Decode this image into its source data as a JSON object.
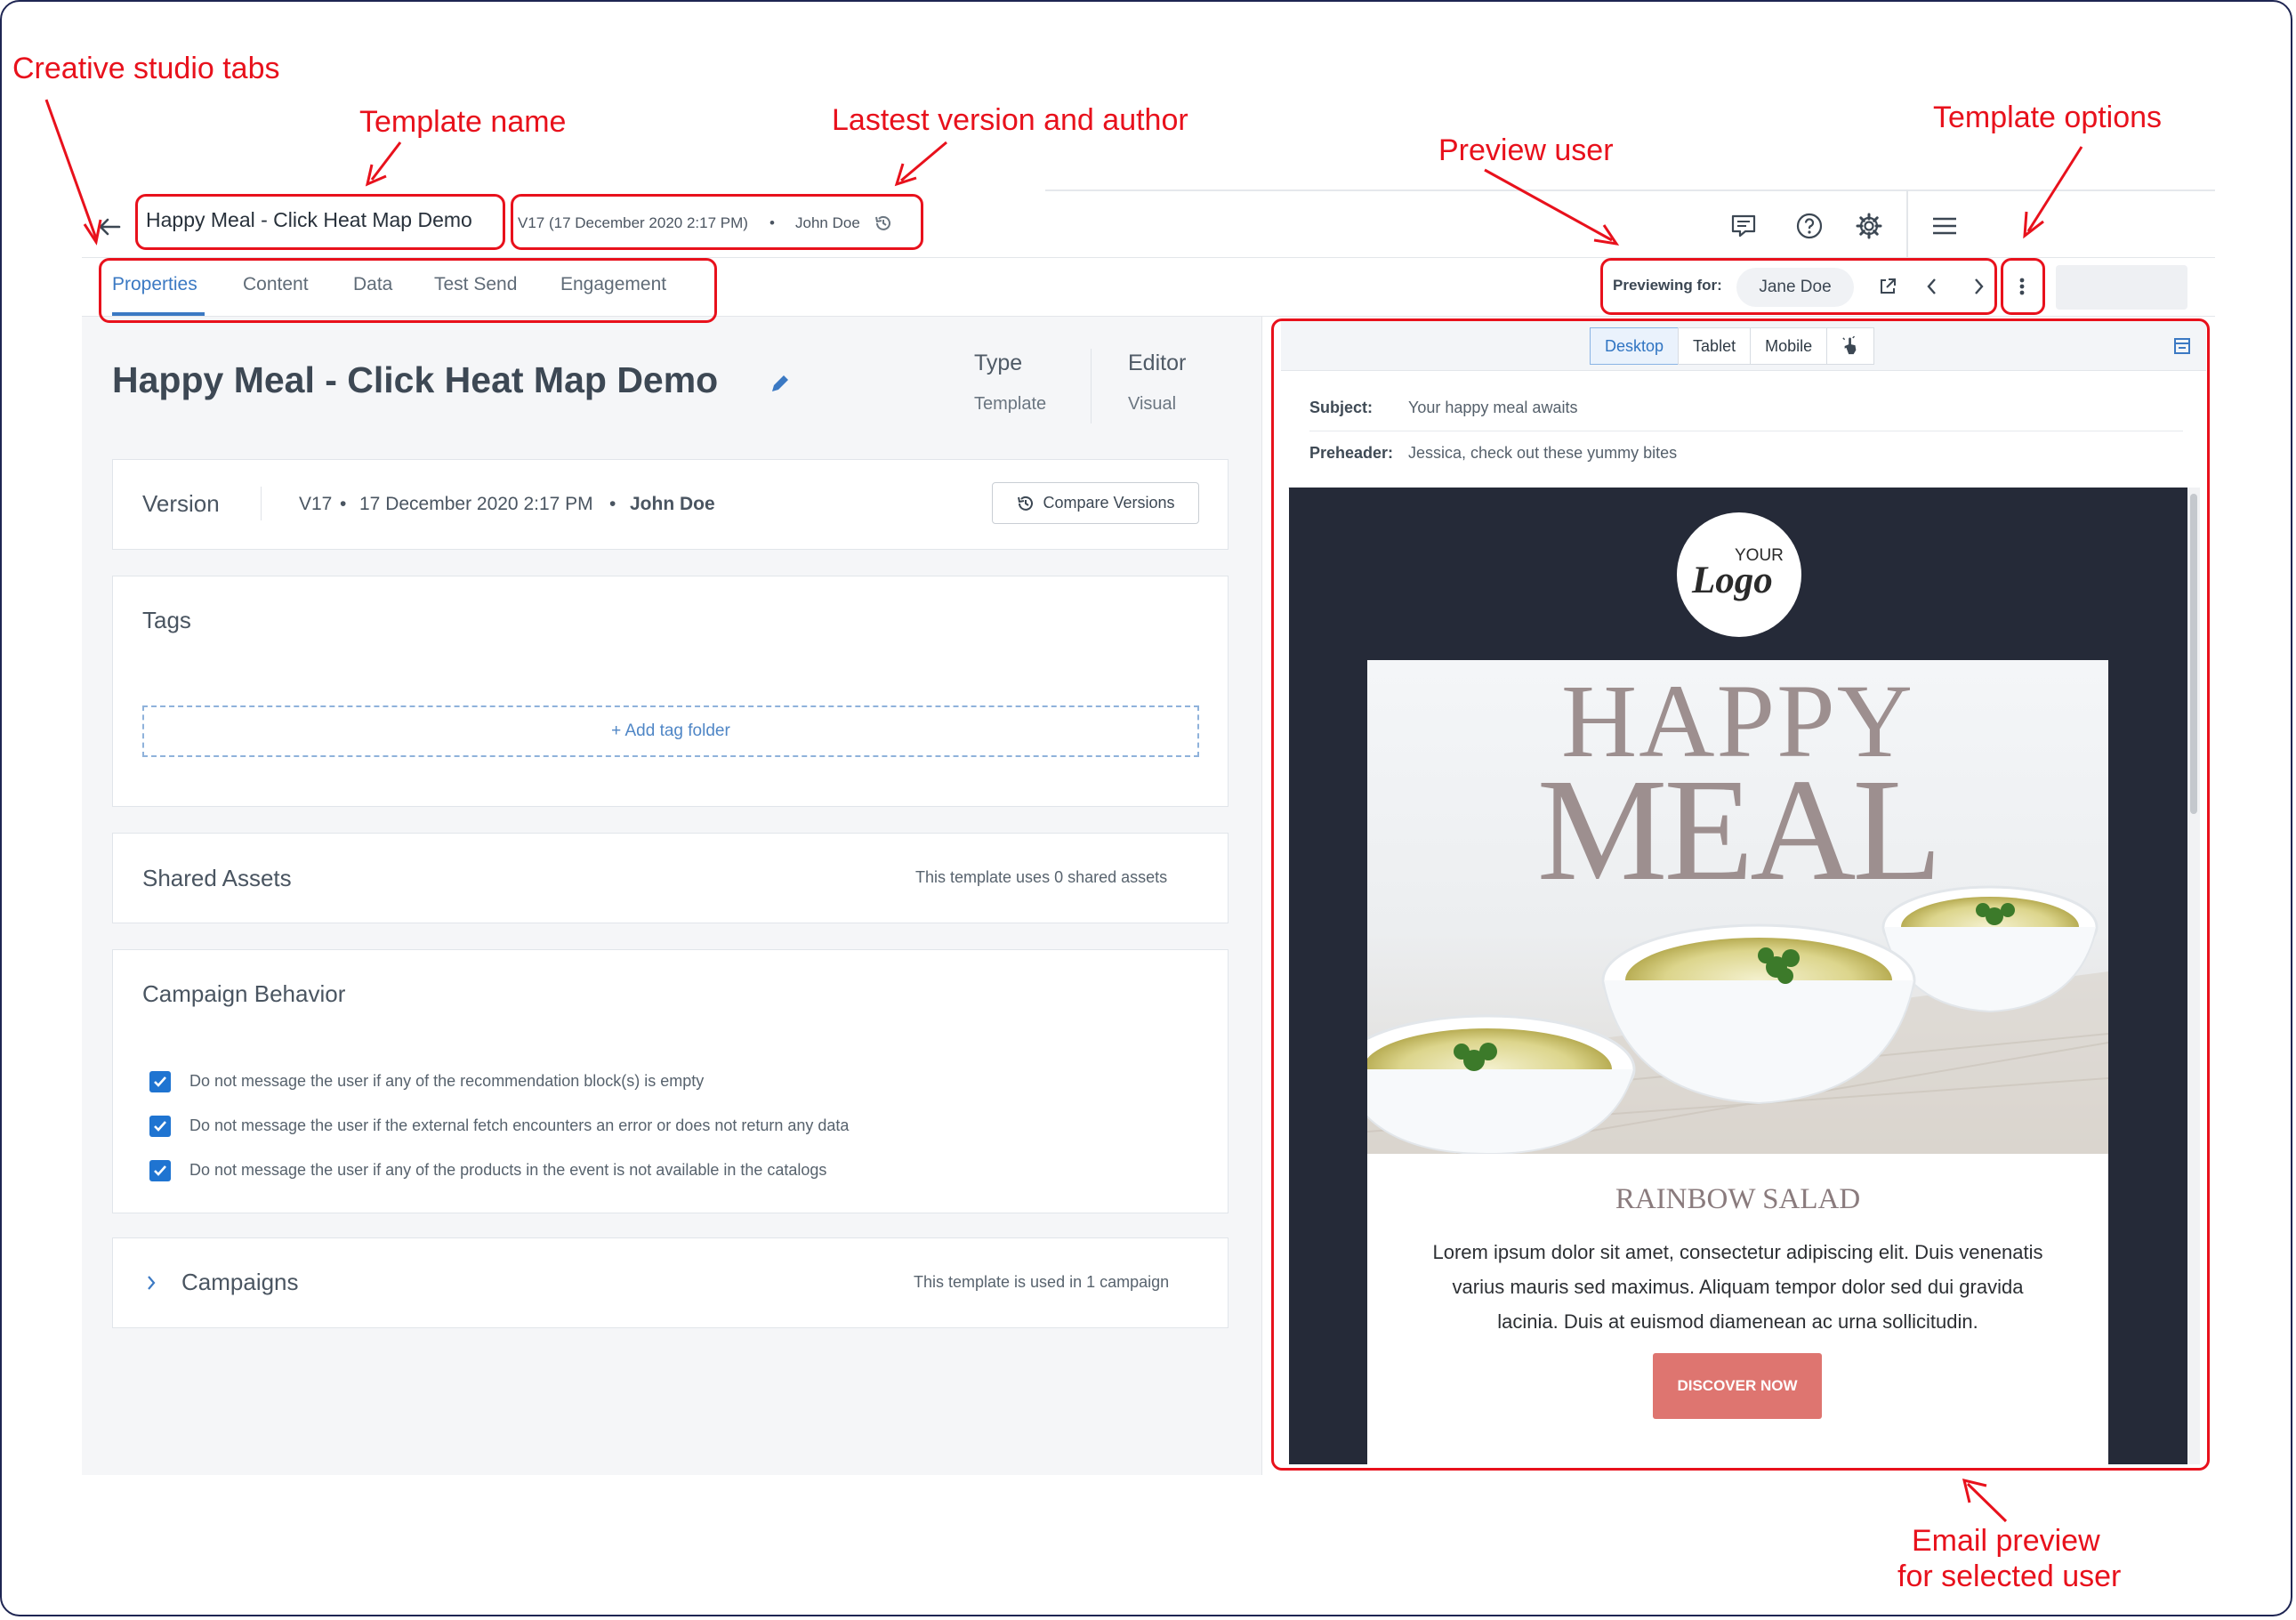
{
  "annotations": {
    "creative_studio_tabs": "Creative studio tabs",
    "template_name": "Template name",
    "latest_version_author": "Lastest version and author",
    "preview_user": "Preview user",
    "template_options": "Template options",
    "email_preview_line1": "Email preview",
    "email_preview_line2": "for selected user",
    "color": "#e8111c"
  },
  "header": {
    "template_name": "Happy Meal - Click Heat Map Demo",
    "version": "V17 (17 December 2020 2:17 PM)",
    "separator": "•",
    "author": "John Doe"
  },
  "tabs": [
    "Properties",
    "Content",
    "Data",
    "Test Send",
    "Engagement"
  ],
  "preview": {
    "label": "Previewing for:",
    "user": "Jane Doe"
  },
  "properties": {
    "title": "Happy Meal - Click Heat Map Demo",
    "type_label": "Type",
    "type_value": "Template",
    "editor_label": "Editor",
    "editor_value": "Visual",
    "version_label": "Version",
    "version_value": "V17",
    "version_date": "17 December 2020 2:17 PM",
    "version_author": "John Doe",
    "dot": "•",
    "compare_button": "Compare Versions",
    "tags_label": "Tags",
    "add_tag_folder": "+ Add tag folder",
    "shared_assets_label": "Shared Assets",
    "shared_assets_info": "This template uses 0 shared assets",
    "campaign_behavior_label": "Campaign Behavior",
    "checks": [
      "Do not message the user if any of the recommendation block(s) is empty",
      "Do not message the user if the external fetch encounters an error or does not return any data",
      "Do not message the user if any of the products in the event is not available in the catalogs"
    ],
    "campaigns_label": "Campaigns",
    "campaigns_info": "This template is used in 1 campaign"
  },
  "device_tabs": [
    "Desktop",
    "Tablet",
    "Mobile"
  ],
  "email": {
    "subject_label": "Subject:",
    "subject_value": "Your happy meal awaits",
    "preheader_label": "Preheader:",
    "preheader_value": "Jessica, check out these yummy bites",
    "logo_top": "YOUR",
    "logo_main": "Logo",
    "hero_line1": "HAPPY",
    "hero_line2": "MEAL",
    "heading": "RAINBOW SALAD",
    "body_line1": "Lorem ipsum dolor sit amet, consectetur adipiscing elit. Duis venenatis",
    "body_line2": "varius mauris sed maximus. Aliquam tempor dolor sed dui gravida",
    "body_line3": "lacinia. Duis at euismod diamenean ac urna sollicitudin.",
    "cta": "DISCOVER NOW"
  },
  "colors": {
    "accent_blue": "#3b79c3",
    "checkbox_blue": "#1f74d1",
    "email_bg": "#252a38",
    "cta": "#de7570",
    "hero_text": "#9d8f8f"
  },
  "icons": [
    "back-arrow-icon",
    "history-icon",
    "comment-icon",
    "help-icon",
    "gear-icon",
    "menu-icon",
    "kebab-icon",
    "external-link-icon",
    "chevron-left-icon",
    "chevron-right-icon",
    "pointer-icon",
    "panel-icon",
    "pencil-icon",
    "chevron-right-small-icon",
    "check-icon"
  ]
}
